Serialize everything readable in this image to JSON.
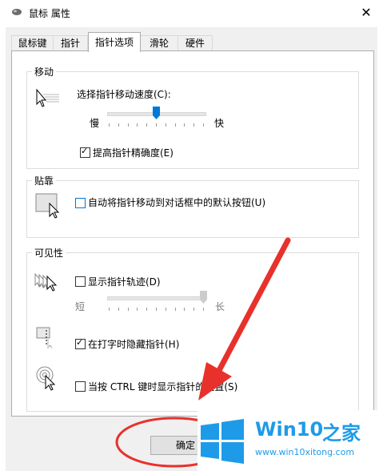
{
  "window": {
    "title": "鼠标 属性",
    "close_glyph": "✕"
  },
  "tabs": [
    {
      "label": "鼠标键",
      "active": false
    },
    {
      "label": "指针",
      "active": false
    },
    {
      "label": "指针选项",
      "active": true
    },
    {
      "label": "滑轮",
      "active": false
    },
    {
      "label": "硬件",
      "active": false
    }
  ],
  "motion": {
    "group_title": "移动",
    "speed_label": "选择指针移动速度(C):",
    "slow_label": "慢",
    "fast_label": "快",
    "speed_value": 0.5,
    "precision_label": "提高指针精确度(E)",
    "precision_checked": true
  },
  "snap": {
    "group_title": "贴靠",
    "snap_label": "自动将指针移动到对话框中的默认按钮(U)",
    "snap_checked": false
  },
  "visibility": {
    "group_title": "可见性",
    "trails_label": "显示指针轨迹(D)",
    "trails_checked": false,
    "short_label": "短",
    "long_label": "长",
    "trails_value": 1.0,
    "hide_label": "在打字时隐藏指针(H)",
    "hide_checked": true,
    "ctrl_label": "当按 CTRL 键时显示指针的位置(S)",
    "ctrl_checked": false
  },
  "footer": {
    "ok_label": "确定"
  },
  "watermark": {
    "brand": "Win10",
    "brand_cn": "之家",
    "url": "www.win10xitong.com"
  },
  "colors": {
    "accent": "#0078d7",
    "annotation": "#e8312b",
    "logo_blue": "#1e9be8"
  }
}
